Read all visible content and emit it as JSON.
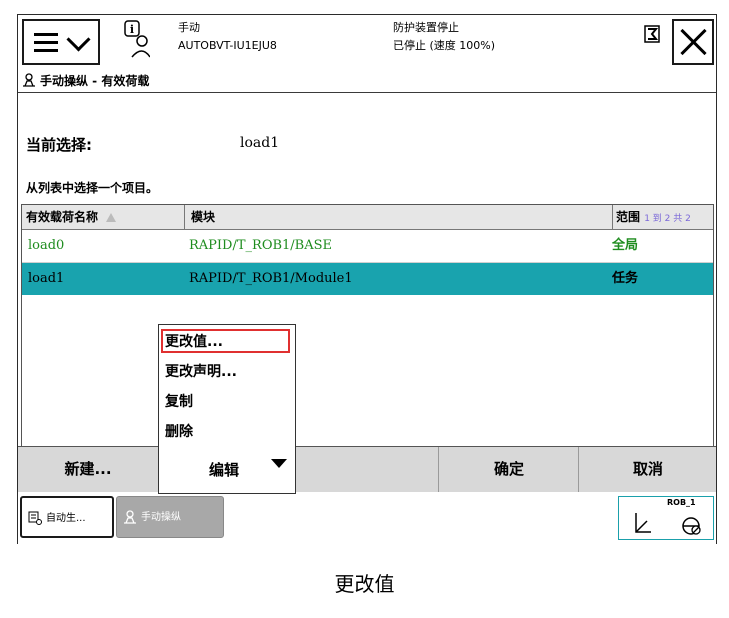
{
  "status": {
    "mode": "手动",
    "controller": "AUTOBVT-IU1EJU8",
    "guard_status": "防护装置停止",
    "run_status": "已停止 (速度 100%)"
  },
  "breadcrumb": "手动操纵 - 有效荷载",
  "selection": {
    "label": "当前选择:",
    "value": "load1"
  },
  "hint": "从列表中选择一个项目。",
  "table": {
    "headers": [
      "有效载荷名称",
      "模块",
      "范围"
    ],
    "range_info": "1 到 2 共 2",
    "rows": [
      {
        "name": "load0",
        "module": "RAPID/T_ROB1/BASE",
        "scope": "全局"
      },
      {
        "name": "load1",
        "module": "RAPID/T_ROB1/Module1",
        "scope": "任务"
      }
    ]
  },
  "context_menu": {
    "items": [
      "更改值...",
      "更改声明...",
      "复制",
      "删除"
    ]
  },
  "commands": {
    "new": "新建...",
    "edit": "编辑",
    "ok": "确定",
    "cancel": "取消"
  },
  "taskbar": {
    "task1": "自动生...",
    "task2": "手动操纵",
    "robot": "ROB_1"
  },
  "caption": "更改值",
  "colors": {
    "selected_row": "#19a3ae",
    "global_text": "#1e8c1e",
    "highlight_border": "#e03030"
  }
}
